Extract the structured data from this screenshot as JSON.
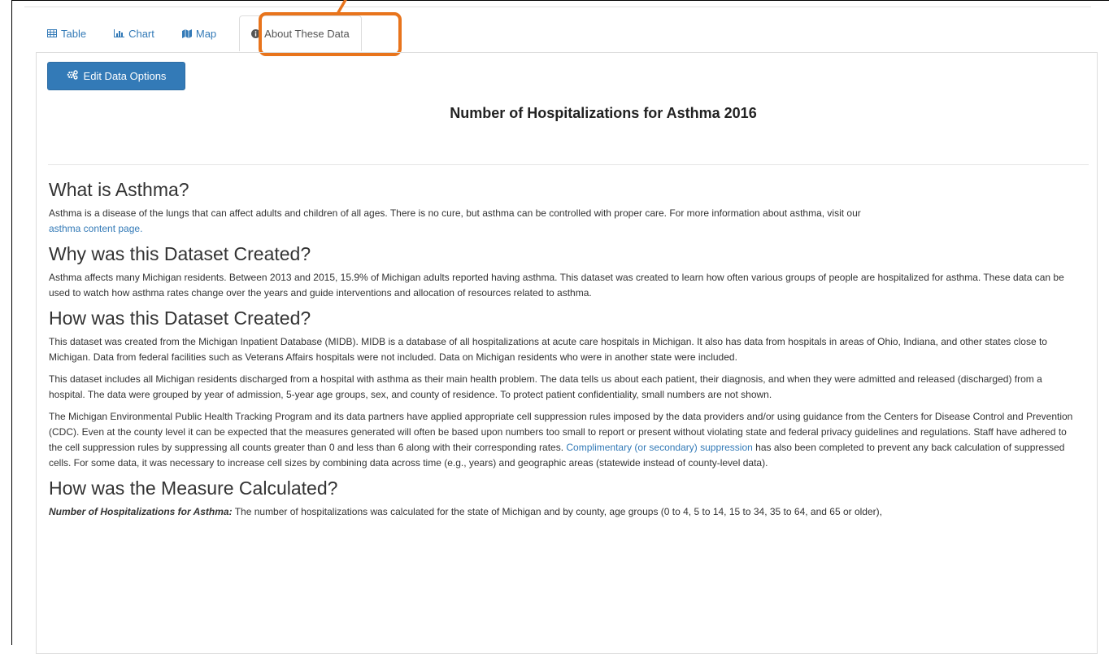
{
  "tabs": [
    {
      "label": "Table",
      "icon": "table-icon"
    },
    {
      "label": "Chart",
      "icon": "bar-chart-icon"
    },
    {
      "label": "Map",
      "icon": "map-icon"
    },
    {
      "label": "About These Data",
      "icon": "info-circle-icon",
      "active": true
    }
  ],
  "toolbar": {
    "edit_label": "Edit Data Options"
  },
  "page": {
    "title": "Number of Hospitalizations for Asthma 2016"
  },
  "colors": {
    "accent": "#337ab7",
    "highlight": "#e8741c"
  },
  "sections": {
    "what": {
      "heading": "What is Asthma?",
      "p1": "Asthma is a disease of the lungs that can affect adults and children of all ages. There is no cure, but asthma can be controlled with proper care. For more information about asthma, visit our",
      "link": "asthma content page."
    },
    "why": {
      "heading": "Why was this Dataset Created?",
      "p1": "Asthma affects many Michigan residents. Between 2013 and 2015, 15.9% of Michigan adults reported having asthma. This dataset was created to learn how often various groups of people are hospitalized for asthma. These data can be used to watch how asthma rates change over the years and guide interventions and allocation of resources related to asthma."
    },
    "how": {
      "heading": "How was this Dataset Created?",
      "p1": "This dataset was created from the Michigan Inpatient Database (MIDB). MIDB is a database of all hospitalizations at acute care hospitals in Michigan. It also has data from hospitals in areas of Ohio, Indiana, and other states close to Michigan. Data from federal facilities such as Veterans Affairs hospitals were not included. Data on Michigan residents who were in another state were included.",
      "p2": "This dataset includes all Michigan residents discharged from a hospital with asthma as their main health problem. The data tells us about each patient, their diagnosis, and when they were admitted and released (discharged) from a hospital. The data were grouped by year of admission, 5-year age groups, sex, and county of residence. To protect patient confidentiality, small numbers are not shown.",
      "p3_before": "The Michigan Environmental Public Health Tracking Program and its data partners have applied appropriate cell suppression rules imposed by the data providers and/or using guidance from the Centers for Disease Control and Prevention (CDC). Even at the county level it can be expected that the measures generated will often be based upon numbers too small to report or present without violating state and federal privacy guidelines and regulations. Staff have adhered to the cell suppression rules by suppressing all counts greater than 0 and less than 6 along with their corresponding rates.",
      "p3_link": "Complimentary (or secondary) suppression",
      "p3_after": "has also been completed to prevent any back calculation of suppressed cells. For some data, it was necessary to increase cell sizes by combining data across time (e.g., years) and geographic areas (statewide instead of county-level data)."
    },
    "measure": {
      "heading": "How was the Measure Calculated?",
      "term": "Number of Hospitalizations for Asthma:",
      "p1": "The number of hospitalizations was calculated for the state of Michigan and by county, age groups (0 to 4, 5 to 14, 15 to 34, 35 to 64, and 65 or older),"
    }
  }
}
